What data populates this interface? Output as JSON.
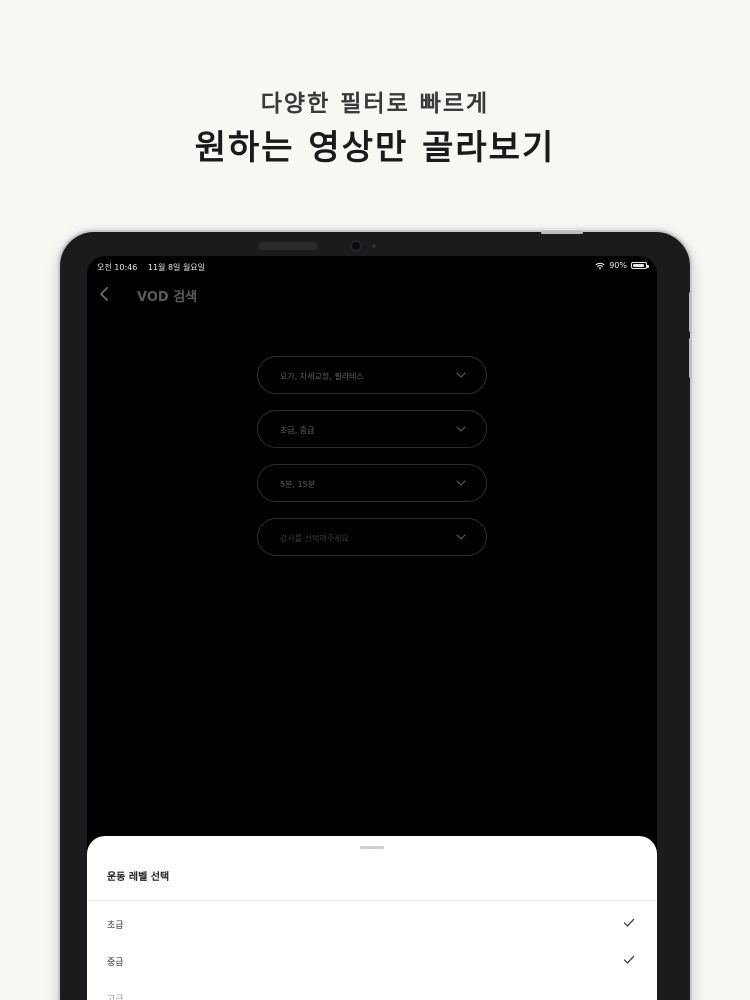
{
  "headline": {
    "sub": "다양한 필터로 빠르게",
    "main": "원하는 영상만 골라보기"
  },
  "status_bar": {
    "time": "오전 10:46",
    "date": "11월 8일 월요일",
    "battery": "90%",
    "battery_level": 0.9,
    "wifi_icon": "wifi-icon",
    "battery_icon": "battery-icon"
  },
  "nav": {
    "back_icon": "chevron-left-icon",
    "title": "VOD 검색"
  },
  "filters": [
    {
      "value": "요가, 자세교정, 필라테스",
      "placeholder": false
    },
    {
      "value": "초급, 중급",
      "placeholder": false
    },
    {
      "value": "5분, 15분",
      "placeholder": false
    },
    {
      "value": "강사를 선택해주세요",
      "placeholder": true
    }
  ],
  "sheet": {
    "title": "운동 레벨 선택",
    "options": [
      {
        "label": "초급",
        "checked": true
      },
      {
        "label": "중급",
        "checked": true
      },
      {
        "label": "고급",
        "checked": false
      }
    ]
  },
  "colors": {
    "background": "#f8f7f3",
    "screen": "#000000",
    "sheet": "#ffffff"
  }
}
